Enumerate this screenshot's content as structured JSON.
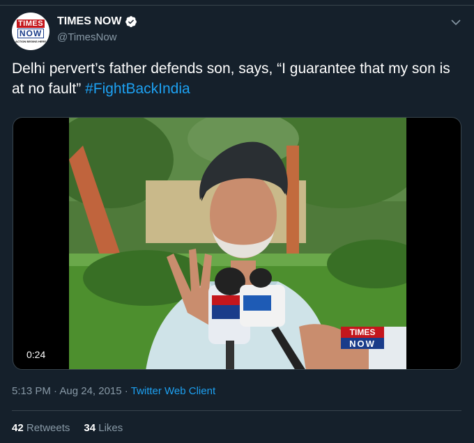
{
  "tweet": {
    "display_name": "TIMES NOW",
    "handle": "@TimesNow",
    "text_main": "Delhi pervert’s father defends son, says, “I guarantee that my son is at no fault”",
    "hashtag": "#FightBackIndia",
    "timestamp": "5:13 PM · Aug 24, 2015",
    "separator": " · ",
    "client": "Twitter Web Client",
    "retweets_count": "42",
    "retweets_label": "Retweets",
    "likes_count": "34",
    "likes_label": "Likes"
  },
  "avatar": {
    "logo_line1": "TIMES",
    "logo_line2": "NOW",
    "logo_tagline": "ACTION BEGINS HERE"
  },
  "video": {
    "duration": "0:24",
    "watermark_line1": "TIMES",
    "watermark_line2": "NOW",
    "mic_logo_1": "TIMES NOW",
    "mic_logo_2": "NEWS X"
  },
  "icons": {
    "verified": "verified-badge-icon",
    "more": "chevron-down-icon"
  },
  "colors": {
    "background": "#15202b",
    "link": "#1da1f2",
    "secondary_text": "#8899a6",
    "divider": "#38444d",
    "brand_red": "#c4161c",
    "brand_blue": "#1a3c8a"
  }
}
